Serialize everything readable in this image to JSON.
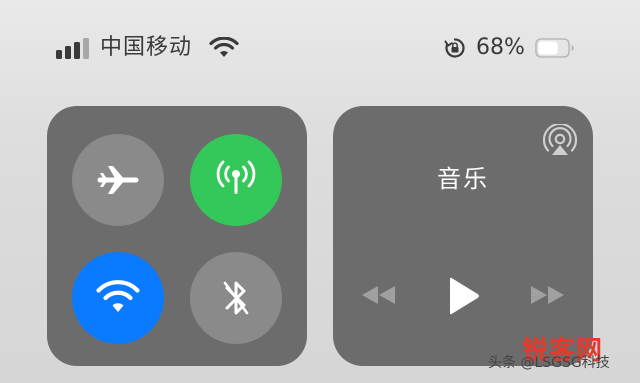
{
  "status_bar": {
    "carrier": "中国移动",
    "battery_percent": "68%",
    "signal_bars_active": 3,
    "signal_bars_total": 4,
    "battery_level": 0.68
  },
  "connectivity": {
    "airplane_mode": {
      "enabled": false,
      "color": "#8a8a8a"
    },
    "cellular_data": {
      "enabled": true,
      "color": "#34c759"
    },
    "wifi": {
      "enabled": true,
      "color": "#0a7aff"
    },
    "bluetooth": {
      "enabled": false,
      "color": "#8a8a8a"
    }
  },
  "music": {
    "title": "音乐",
    "controls": [
      "previous-icon",
      "play-icon",
      "next-icon"
    ]
  },
  "watermark": {
    "brand_1": "锐",
    "brand_2": "客",
    "brand_3": "网",
    "line": "头条 @LSGSG科技"
  },
  "colors": {
    "background": "#dcdcdc",
    "module": "#6c6c6c",
    "accent_green": "#34c759",
    "accent_blue": "#0a7aff",
    "brand_red": "#e23a2b"
  }
}
